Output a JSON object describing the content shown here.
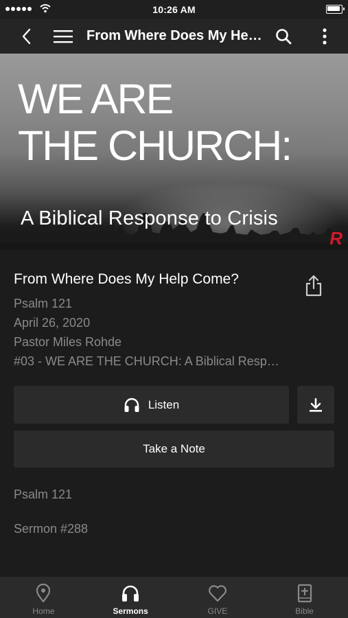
{
  "status_bar": {
    "time": "10:26 AM"
  },
  "header": {
    "title": "From Where Does My Help Come?"
  },
  "banner": {
    "title": "WE ARE\nTHE CHURCH:",
    "subtitle": "A Biblical Response to Crisis",
    "logo_text": "R"
  },
  "sermon": {
    "title": "From Where Does My Help Come?",
    "passage": "Psalm 121",
    "date": "April 26, 2020",
    "speaker": "Pastor Miles Rohde",
    "series": "#03 - WE ARE THE CHURCH: A Biblical Response to Crisis"
  },
  "actions": {
    "listen_label": "Listen",
    "note_label": "Take a Note"
  },
  "extras": {
    "passage": "Psalm 121",
    "number": "Sermon #288"
  },
  "tabs": [
    {
      "label": "Home",
      "icon": "location-pin-icon",
      "active": false
    },
    {
      "label": "Sermons",
      "icon": "headphones-icon",
      "active": true
    },
    {
      "label": "GIVE",
      "icon": "heart-icon",
      "active": false
    },
    {
      "label": "Bible",
      "icon": "bible-icon",
      "active": false
    }
  ],
  "colors": {
    "background": "#1c1c1c",
    "header": "#262525",
    "button": "#2b2b2b",
    "muted_text": "#8a8a8a",
    "brand_red": "#d01a2a"
  }
}
